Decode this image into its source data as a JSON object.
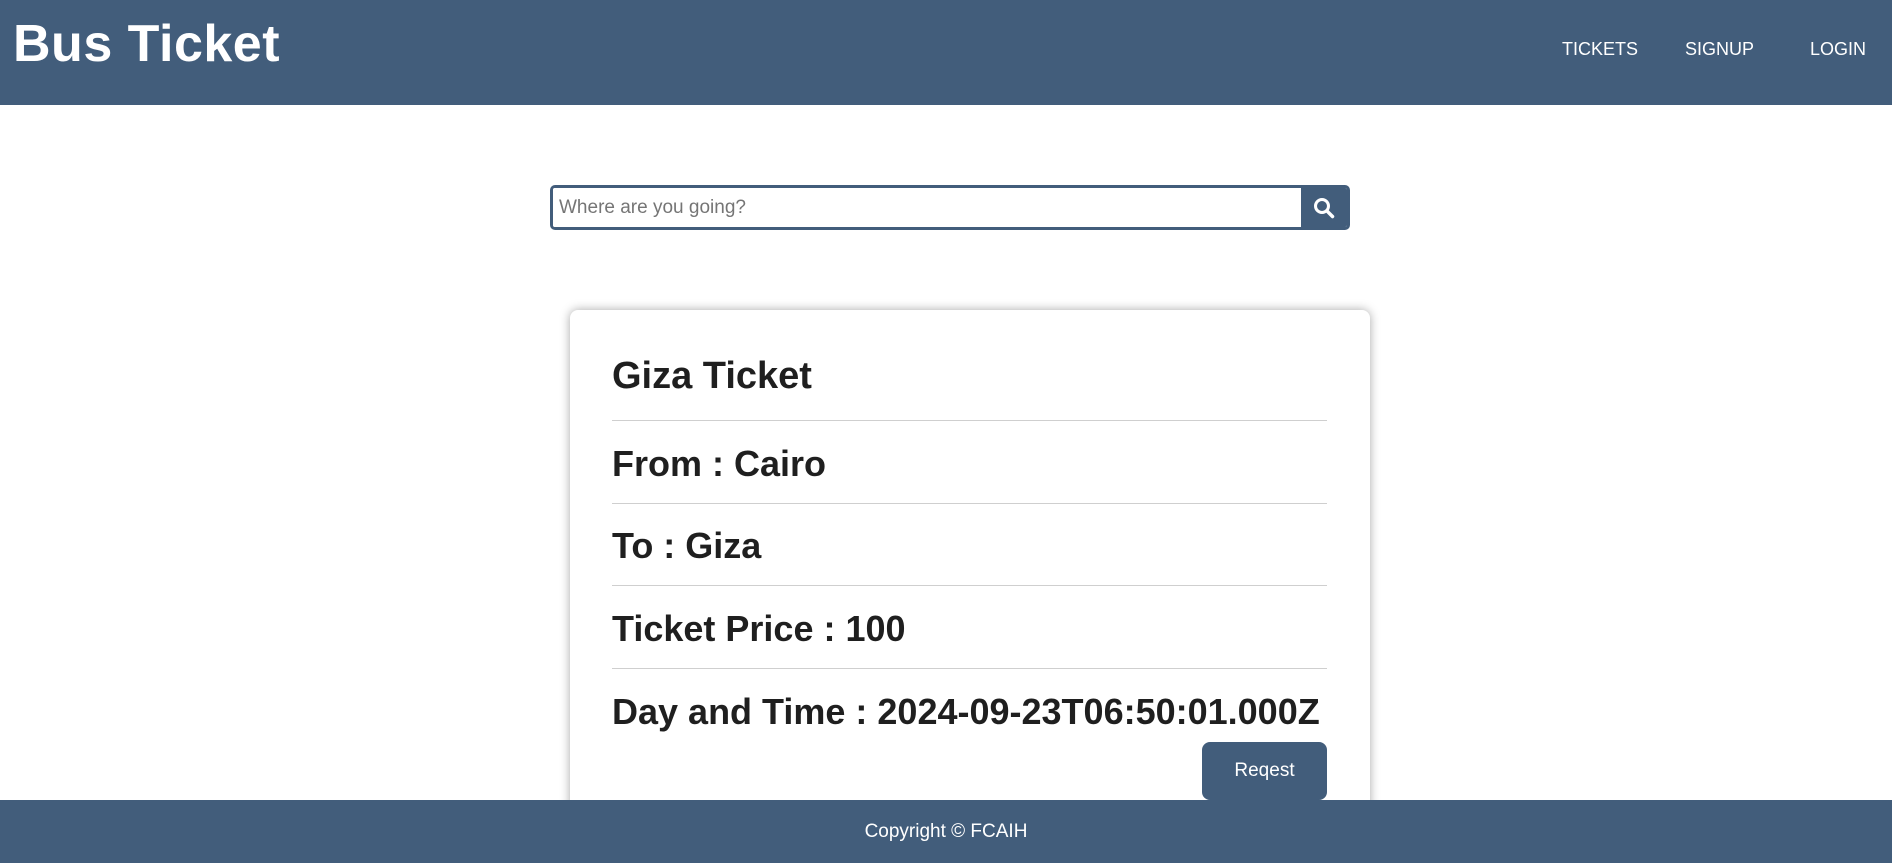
{
  "navbar": {
    "brand": "Bus Ticket",
    "links": {
      "tickets": "TICKETS",
      "signup": "SIGNUP",
      "login": "LOGIN"
    },
    "background": "#425d7b"
  },
  "search": {
    "placeholder": "Where are you going?",
    "value": "",
    "icon": "search-icon"
  },
  "ticket": {
    "title": "Giza Ticket",
    "from": "From : Cairo",
    "to": "To : Giza",
    "price": "Ticket Price : 100",
    "datetime": "Day and Time : 2024-09-23T06:50:01.000Z",
    "request_label": "Reqest"
  },
  "footer": {
    "copyright": "Copyright © FCAIH"
  }
}
